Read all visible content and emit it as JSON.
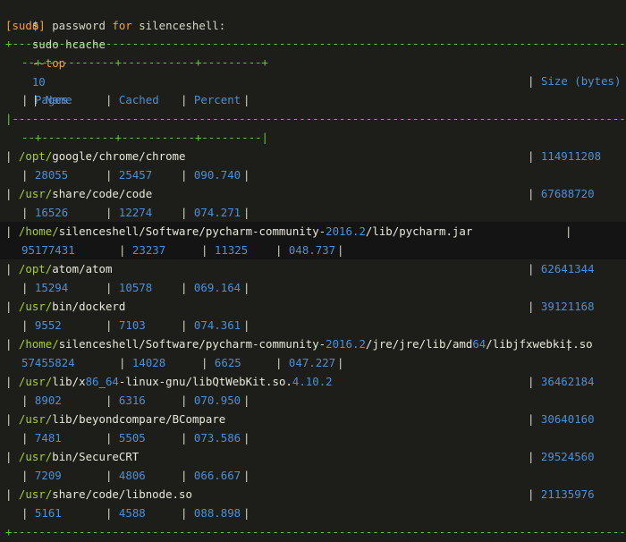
{
  "command": {
    "prompt": "$",
    "program": "sudo hcache",
    "flag": "--top",
    "value": "10"
  },
  "password_prompt": {
    "prefix": "[sudo]",
    "text": " password ",
    "for": "for",
    "user": " silenceshell:"
  },
  "border_top": "+---------------------------------------------------------------------------------------------------+--------------+",
  "border_top2": "--+-----------+-----------+---------+",
  "header": {
    "name": "Name",
    "size": "Size (bytes)",
    "pages": "Pages",
    "cached": "Cached",
    "percent": "Percent"
  },
  "border_mid": "|---------------------------------------------------------------------------------------------------+--------------+",
  "border_mid2": "--+-----------+-----------+---------|",
  "rows": [
    {
      "name": "/opt/google/chrome/chrome",
      "size": "114911208",
      "pages": "28055",
      "cached": "25457",
      "percent": "090.740"
    },
    {
      "name": "/usr/share/code/code",
      "size": "67688720",
      "pages": "16526",
      "cached": "12274",
      "percent": "074.271"
    },
    {
      "name": "/home/silenceshell/Software/pycharm-community-2016.2/lib/pycharm.jar",
      "size": "95177431",
      "pages": "23237",
      "cached": "11325",
      "percent": "048.737"
    },
    {
      "name": "/opt/atom/atom",
      "size": "62641344",
      "pages": "15294",
      "cached": "10578",
      "percent": "069.164"
    },
    {
      "name": "/usr/bin/dockerd",
      "size": "39121168",
      "pages": "9552",
      "cached": "7103",
      "percent": "074.361"
    },
    {
      "name": "/home/silenceshell/Software/pycharm-community-2016.2/jre/jre/lib/amd64/libjfxwebkit.so",
      "size": "57455824",
      "pages": "14028",
      "cached": "6625",
      "percent": "047.227"
    },
    {
      "name": "/usr/lib/x86_64-linux-gnu/libQtWebKit.so.4.10.2",
      "size": "36462184",
      "pages": "8902",
      "cached": "6316",
      "percent": "070.950"
    },
    {
      "name": "/usr/lib/beyondcompare/BCompare",
      "size": "30640160",
      "pages": "7481",
      "cached": "5505",
      "percent": "073.586"
    },
    {
      "name": "/usr/bin/SecureCRT",
      "size": "29524560",
      "pages": "7209",
      "cached": "4806",
      "percent": "066.667"
    },
    {
      "name": "/usr/share/code/libnode.so",
      "size": "21135976",
      "pages": "5161",
      "cached": "4588",
      "percent": "088.898"
    }
  ],
  "border_bottom": "+--------------------------------------------------------------------------------------------------+"
}
